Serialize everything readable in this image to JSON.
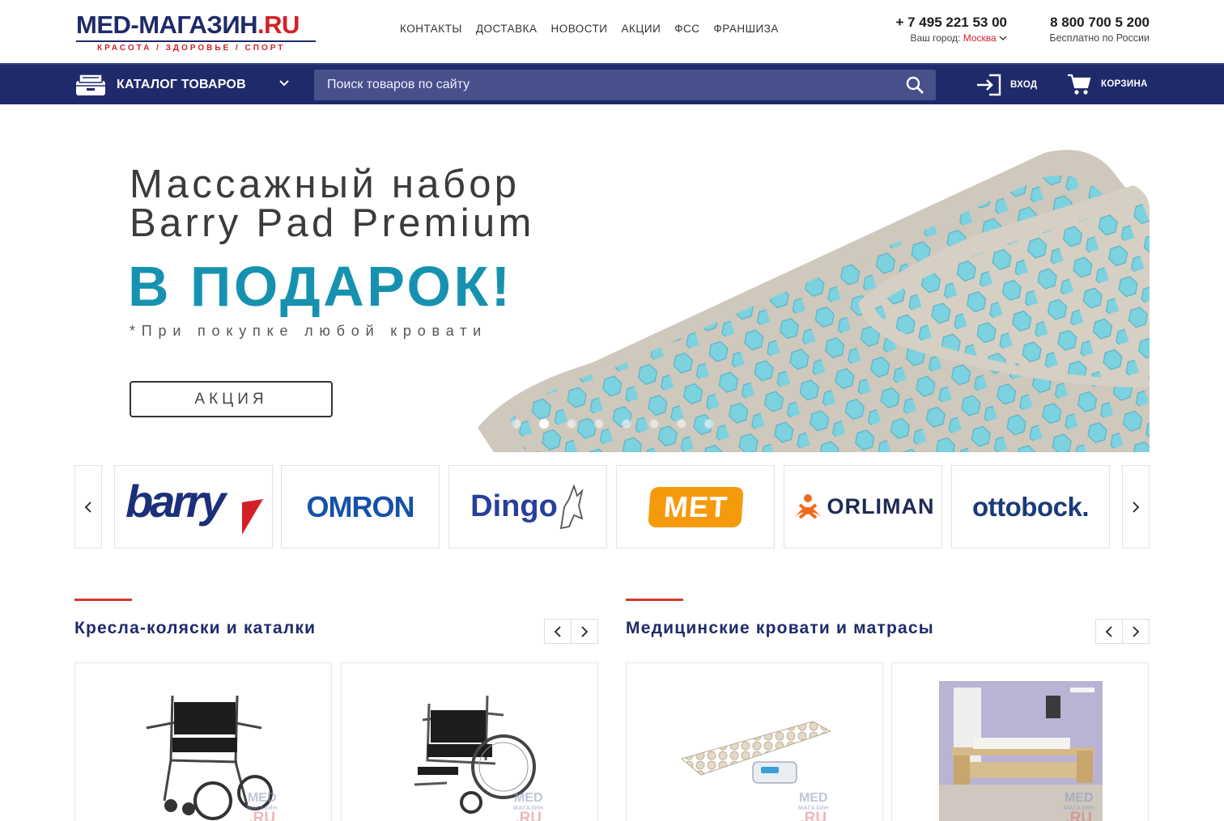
{
  "header": {
    "logo_main": "MED-МАГАЗИН",
    "logo_domain": ".RU",
    "logo_tagline": "КРАСОТА / ЗДОРОВЬЕ / СПОРТ",
    "nav": [
      "КОНТАКТЫ",
      "ДОСТАВКА",
      "НОВОСТИ",
      "АКЦИИ",
      "ФСС",
      "ФРАНШИЗА"
    ],
    "phone_city": "+ 7 495 221 53 00",
    "city_label": "Ваш город:",
    "city_value": "Москва",
    "phone_free": "8 800 700 5 200",
    "phone_free_note": "Бесплатно по России"
  },
  "navbar": {
    "catalog_label": "КАТАЛОГ ТОВАРОВ",
    "search_placeholder": "Поиск товаров по сайту",
    "login_label": "ВХОД",
    "cart_label": "КОРЗИНА"
  },
  "hero": {
    "title_line1": "Массажный набор",
    "title_line2": "Barry Pad Premium",
    "gift": "В ПОДАРОК!",
    "note": "*При покупке любой кровати",
    "button": "АКЦИЯ",
    "slides_total": 8,
    "active_slide": 2
  },
  "brands": {
    "items": [
      "barry",
      "OMRON",
      "Dingo",
      "MET",
      "ORLIMAN",
      "ottobock."
    ],
    "prev_icon": "chevron-left-icon",
    "next_icon": "chevron-right-icon"
  },
  "sections": [
    {
      "title": "Кресла-коляски и каталки",
      "products": [
        "wheelchair-light",
        "wheelchair-standard"
      ]
    },
    {
      "title": "Медицинские кровати и матрасы",
      "products": [
        "anti-decubitus-mattress",
        "medical-bed"
      ]
    }
  ],
  "watermark": {
    "line1": "MED",
    "line2": "МАГАЗИН",
    "line3": ".RU"
  },
  "colors": {
    "brand_navy": "#1f2a6b",
    "brand_red": "#d32027",
    "accent_teal": "#1692b0",
    "search_bg": "#47508a"
  }
}
